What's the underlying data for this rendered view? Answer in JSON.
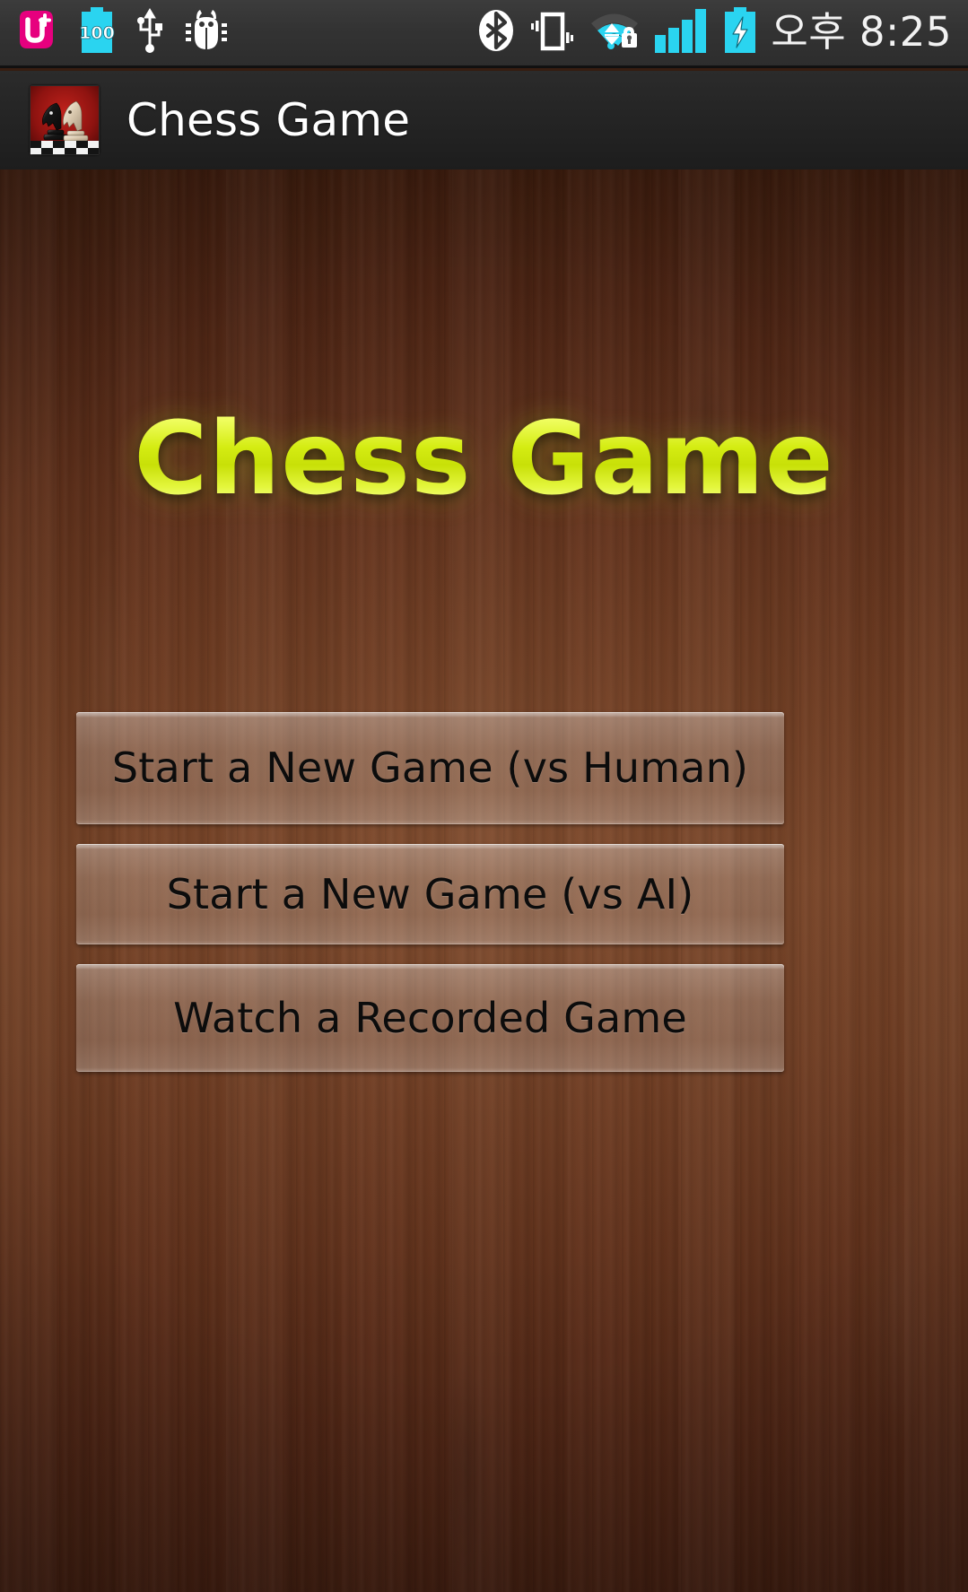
{
  "status_bar": {
    "left_icons": [
      {
        "name": "uplus-carrier-icon",
        "label": "U+"
      },
      {
        "name": "battery-100-icon",
        "label": "100"
      },
      {
        "name": "usb-icon",
        "label": "USB"
      },
      {
        "name": "usb-debug-bug-icon",
        "label": "Debug"
      }
    ],
    "right_icons": [
      {
        "name": "bluetooth-icon",
        "label": "Bluetooth"
      },
      {
        "name": "vibrate-mode-icon",
        "label": "Vibrate"
      },
      {
        "name": "wifi-secured-icon",
        "label": "Wi-Fi"
      },
      {
        "name": "cellular-signal-icon",
        "label": "Signal"
      },
      {
        "name": "battery-charging-icon",
        "label": "Charging"
      }
    ],
    "clock": "오후 8:25"
  },
  "action_bar": {
    "title": "Chess Game",
    "icon_name": "chess-knights-app-icon"
  },
  "logo": {
    "text": "Chess Game",
    "color": "#d9f024"
  },
  "menu": {
    "buttons": [
      {
        "id": "new-game-vs-human",
        "label": "Start a New Game (vs Human)"
      },
      {
        "id": "new-game-vs-ai",
        "label": "Start a New Game (vs AI)"
      },
      {
        "id": "watch-recorded-game",
        "label": "Watch a Recorded Game"
      }
    ]
  },
  "theme": {
    "wood_dark": "#3e1d0e",
    "wood_mid": "#744226",
    "status_bar_bg": "#333333",
    "action_bar_bg": "#242424",
    "accent_cyan": "#2ad4f0",
    "accent_magenta": "#e6007e",
    "button_text": "#0c0c0c"
  }
}
